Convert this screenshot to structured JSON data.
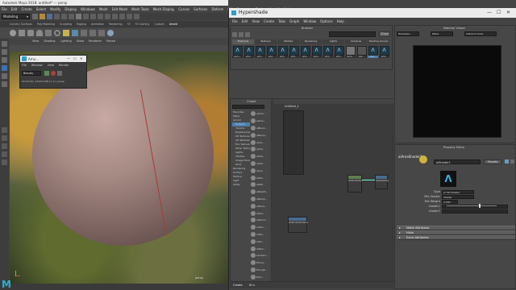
{
  "maya": {
    "title": "Autodesk Maya 2018: untitled* --- persp",
    "menus": [
      "File",
      "Edit",
      "Create",
      "Select",
      "Modify",
      "Display",
      "Windows",
      "Mesh",
      "Edit Mesh",
      "Mesh Tools",
      "Mesh Display",
      "Curves",
      "Surfaces",
      "Deform",
      "UV",
      "Generate",
      "Cache",
      "Arnold",
      "Help"
    ],
    "mode": "Modeling",
    "shelf_tabs": [
      "Curves / Surfaces",
      "Poly Modeling",
      "Sculpting",
      "Rigging",
      "Animation",
      "Rendering",
      "FX",
      "FX Caching",
      "Custom",
      "Arnold"
    ],
    "viewport_menus": [
      "View",
      "Shading",
      "Lighting",
      "Show",
      "Renderer",
      "Panels"
    ],
    "camera_label": "persp",
    "logo": "M"
  },
  "arnold_rv": {
    "title": "Arno...",
    "menus": [
      "File",
      "Window",
      "View",
      "Render"
    ],
    "beauty": "Beauty",
    "status": "00:00:00 | 1920x1080 (1:1) | persp"
  },
  "hypershade": {
    "title": "Hypershade",
    "menus": [
      "File",
      "Edit",
      "View",
      "Create",
      "Tabs",
      "Graph",
      "Window",
      "Options",
      "Help"
    ],
    "browser_label": "Browser",
    "browser_tabs": [
      "Materials",
      "Textures",
      "Utilities",
      "Rendering",
      "Lights",
      "Cameras",
      "Shading Groups"
    ],
    "search_btn": "Show",
    "materials": [
      "aiAm...",
      "aiSt...",
      "aiSt...",
      "aiSt...",
      "aiSt...",
      "aiSt...",
      "aiSt...",
      "aiSt...",
      "aiSt...",
      "aiSt...",
      "lamb...",
      "stan...",
      "aiSt...",
      "aiSt..."
    ],
    "create_label": "Create",
    "create_categories": [
      "Favorites",
      "Maya",
      "Arnold",
      "Surface",
      "Volume",
      "Displacement",
      "2D Textures",
      "3D Textures",
      "Env Textures",
      "Other Textures",
      "Lights",
      "Utilities",
      "Image Planes",
      "Glow",
      "Rendering",
      "Surface",
      "Texture",
      "Light",
      "Utility"
    ],
    "create_nodes": [
      "aiAmb...",
      "aiAnis...",
      "aiBlend...",
      "aiBump...",
      "aiCar...",
      "aiClip...",
      "aiFlat...",
      "aiHair...",
      "aiLay...",
      "aiMix...",
      "aiMat...",
      "aiPassth...",
      "aiRamp...",
      "aiShad...",
      "aiSkin...",
      "aiStand...",
      "aiToon...",
      "aiTwo...",
      "aiVol...",
      "aiWire...",
      "Lambert...",
      "Phong...",
      "PhongE...",
      "Blinn..."
    ],
    "graph_tab": "Untitled_1",
    "graph_nodes": [
      "aiStandardSurface1",
      "pSphereShape1",
      "aiStandardSurface2"
    ],
    "bottom_tabs": [
      "Create",
      "Bins"
    ],
    "material_viewer_label": "Material Viewer",
    "mv_renderer": "Hardware",
    "mv_shape": "Plane",
    "mv_env": "Interior1 Color",
    "property_editor_label": "Property Editor",
    "node_name_label": "aiAreaShader1",
    "node_field": "aiShader1",
    "presets_btn": "Presets",
    "attrs": [
      {
        "label": "Type",
        "value": "Ai Std Shader"
      },
      {
        "label": "Mix Shader",
        "value": "Shader"
      },
      {
        "label": "Mix Weight",
        "value": "0.500"
      },
      {
        "label": "shader1",
        "value": ""
      },
      {
        "label": "shader2",
        "value": ""
      }
    ],
    "sections": [
      "Matte Attributes",
      "Hints",
      "Extra Attributes"
    ]
  }
}
